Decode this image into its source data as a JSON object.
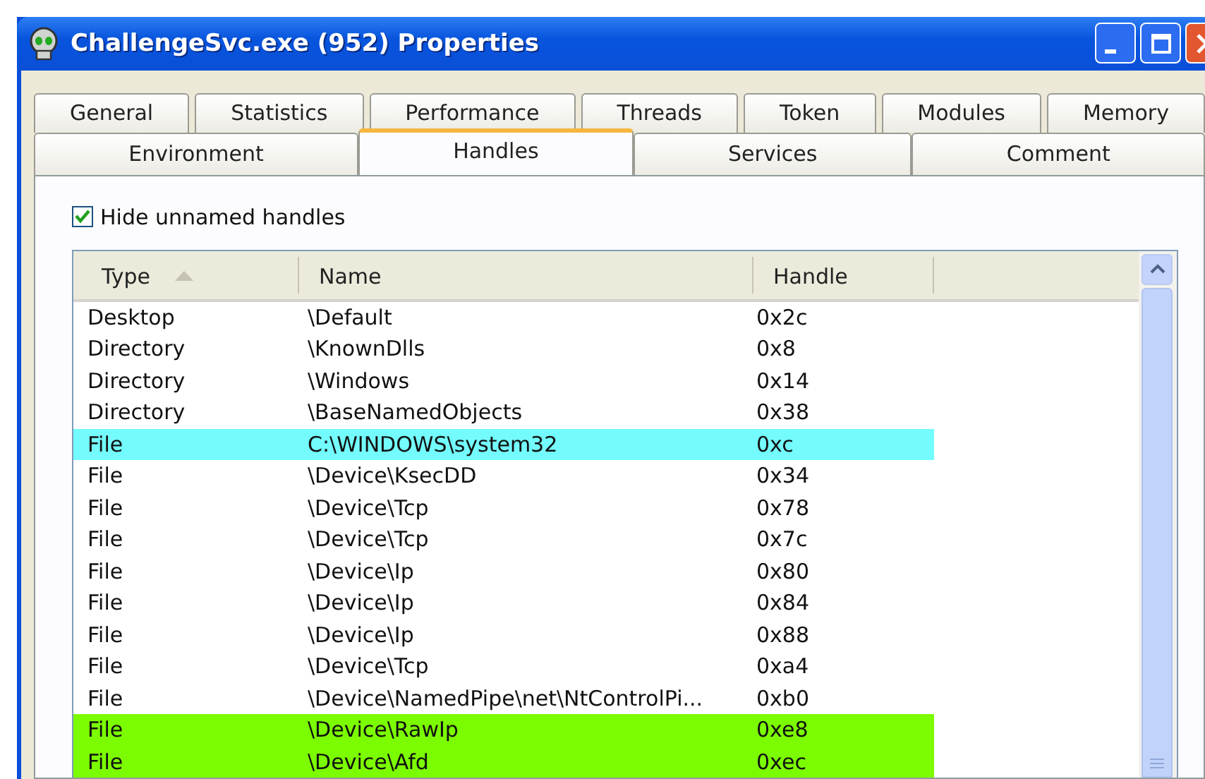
{
  "window": {
    "title": "ChallengeSvc.exe (952) Properties"
  },
  "tabs_row_1": [
    {
      "label": "General",
      "selected": false
    },
    {
      "label": "Statistics",
      "selected": false
    },
    {
      "label": "Performance",
      "selected": false
    },
    {
      "label": "Threads",
      "selected": false
    },
    {
      "label": "Token",
      "selected": false
    },
    {
      "label": "Modules",
      "selected": false
    },
    {
      "label": "Memory",
      "selected": false
    }
  ],
  "tabs_row_2": [
    {
      "label": "Environment",
      "selected": false
    },
    {
      "label": "Handles",
      "selected": true
    },
    {
      "label": "Services",
      "selected": false
    },
    {
      "label": "Comment",
      "selected": false
    }
  ],
  "hide_unnamed": {
    "label": "Hide unnamed handles",
    "checked": true
  },
  "table": {
    "columns": [
      "Type",
      "Name",
      "Handle"
    ],
    "rows": [
      {
        "type": "Desktop",
        "name": "\\Default",
        "handle": "0x2c"
      },
      {
        "type": "Directory",
        "name": "\\KnownDlls",
        "handle": "0x8"
      },
      {
        "type": "Directory",
        "name": "\\Windows",
        "handle": "0x14"
      },
      {
        "type": "Directory",
        "name": "\\BaseNamedObjects",
        "handle": "0x38"
      },
      {
        "type": "File",
        "name": "C:\\WINDOWS\\system32",
        "handle": "0xc",
        "color": "#73fbfd"
      },
      {
        "type": "File",
        "name": "\\Device\\KsecDD",
        "handle": "0x34"
      },
      {
        "type": "File",
        "name": "\\Device\\Tcp",
        "handle": "0x78"
      },
      {
        "type": "File",
        "name": "\\Device\\Tcp",
        "handle": "0x7c"
      },
      {
        "type": "File",
        "name": "\\Device\\Ip",
        "handle": "0x80"
      },
      {
        "type": "File",
        "name": "\\Device\\Ip",
        "handle": "0x84"
      },
      {
        "type": "File",
        "name": "\\Device\\Ip",
        "handle": "0x88"
      },
      {
        "type": "File",
        "name": "\\Device\\Tcp",
        "handle": "0xa4"
      },
      {
        "type": "File",
        "name": "\\Device\\NamedPipe\\net\\NtControlPi...",
        "handle": "0xb0"
      },
      {
        "type": "File",
        "name": "\\Device\\RawIp",
        "handle": "0xe8",
        "color": "#7cfc00"
      },
      {
        "type": "File",
        "name": "\\Device\\Afd",
        "handle": "0xec",
        "color": "#7cfc00"
      }
    ]
  }
}
